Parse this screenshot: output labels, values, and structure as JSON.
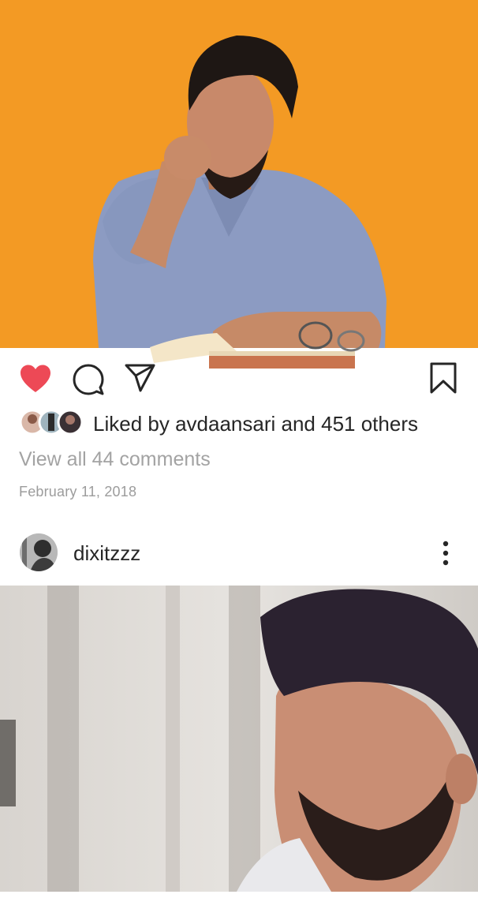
{
  "colors": {
    "photo_background": "#F39A24",
    "like_active": "#ED4956",
    "text_primary": "#262626",
    "text_muted": "#A3A3A3"
  },
  "post": {
    "photo_icon": "portrait-photo",
    "actions": {
      "like_icon": "heart-filled-icon",
      "comment_icon": "comment-icon",
      "share_icon": "paper-plane-icon",
      "save_icon": "bookmark-icon"
    },
    "likes": {
      "prefix": "Liked by ",
      "user": "avdaansari",
      "middle": " and ",
      "others": "451 others"
    },
    "comments_link": "View all 44 comments",
    "date": "February 11, 2018"
  },
  "next_post": {
    "username": "dixitzzz",
    "more_icon": "more-vertical-icon",
    "photo_icon": "portrait-photo"
  }
}
